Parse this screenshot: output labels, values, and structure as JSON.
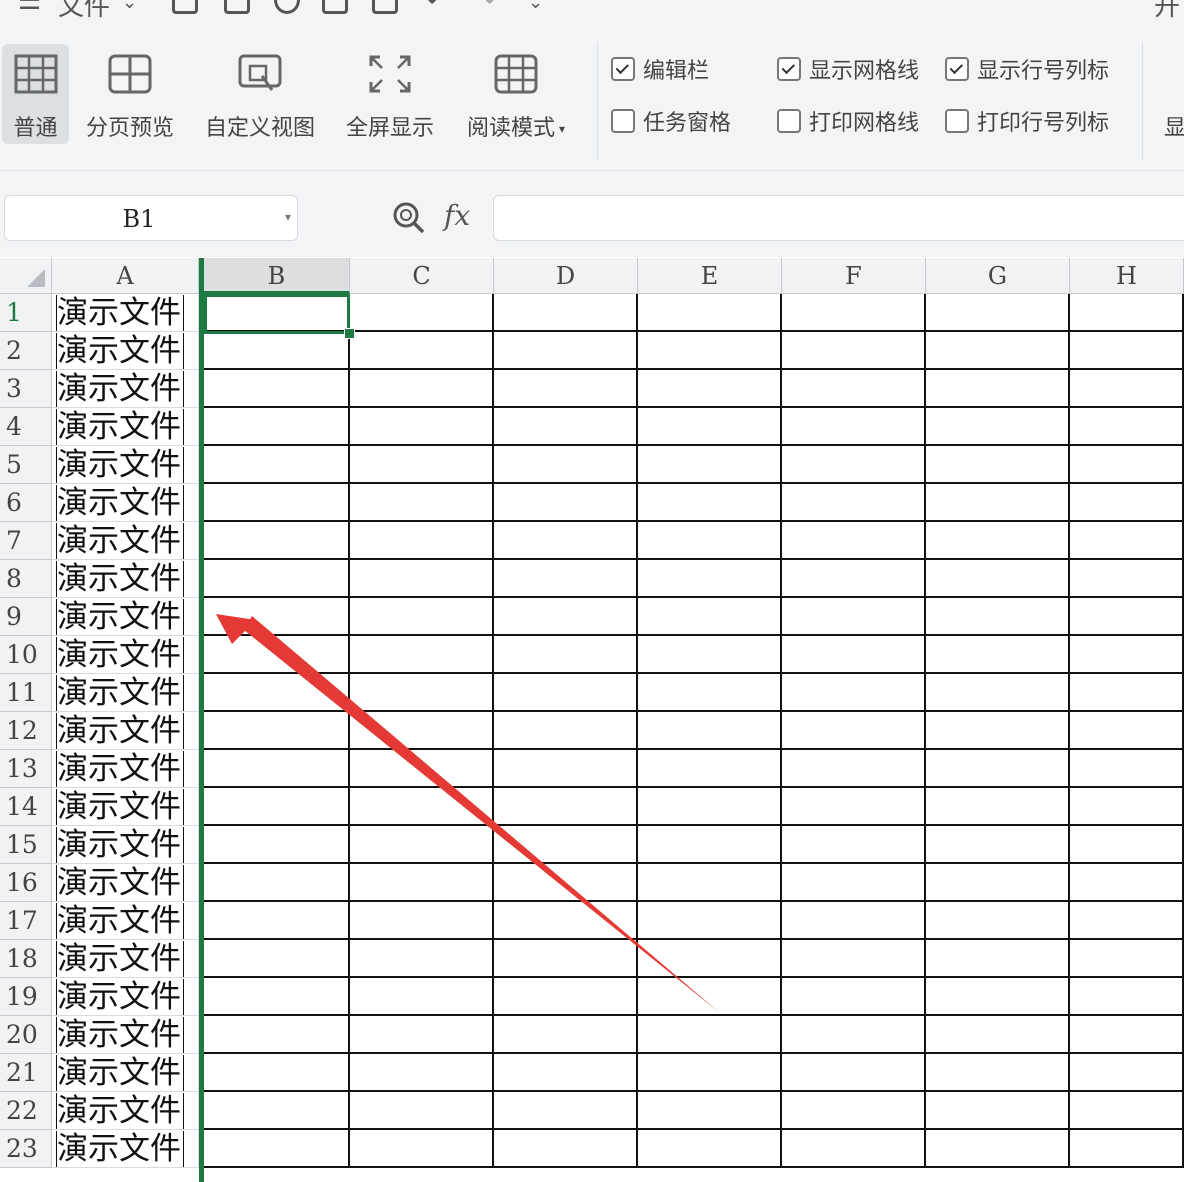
{
  "quick_access": {
    "file_menu_label": "文件",
    "right_label": "开"
  },
  "view_ribbon": {
    "buttons": [
      {
        "label": "普通",
        "icon": "normal-view-icon",
        "active": true
      },
      {
        "label": "分页预览",
        "icon": "page-break-preview-icon"
      },
      {
        "label": "自定义视图",
        "icon": "custom-view-icon"
      },
      {
        "label": "全屏显示",
        "icon": "fullscreen-icon"
      },
      {
        "label": "阅读模式",
        "icon": "reading-mode-icon",
        "has_dropdown": true
      }
    ],
    "checkboxes": [
      {
        "label": "编辑栏",
        "checked": true
      },
      {
        "label": "任务窗格",
        "checked": false
      },
      {
        "label": "显示网格线",
        "checked": true
      },
      {
        "label": "打印网格线",
        "checked": false
      },
      {
        "label": "显示行号列标",
        "checked": true
      },
      {
        "label": "打印行号列标",
        "checked": false
      }
    ],
    "more_label": "显"
  },
  "formula_bar": {
    "name_box": "B1",
    "fx_label": "fx",
    "formula": ""
  },
  "sheet": {
    "columns": [
      "A",
      "B",
      "C",
      "D",
      "E",
      "F",
      "G",
      "H"
    ],
    "selected_column": "B",
    "rows": [
      "1",
      "2",
      "3",
      "4",
      "5",
      "6",
      "7",
      "8",
      "9",
      "10",
      "11",
      "12",
      "13",
      "14",
      "15",
      "16",
      "17",
      "18",
      "19",
      "20",
      "21",
      "22",
      "23"
    ],
    "selected_row": "1",
    "cell_a_text": "演示文件",
    "active_cell": "B1"
  },
  "colors": {
    "accent": "#1e7a43",
    "annotation_arrow": "#e53935",
    "ribbon_bg": "#f3f4f6"
  }
}
